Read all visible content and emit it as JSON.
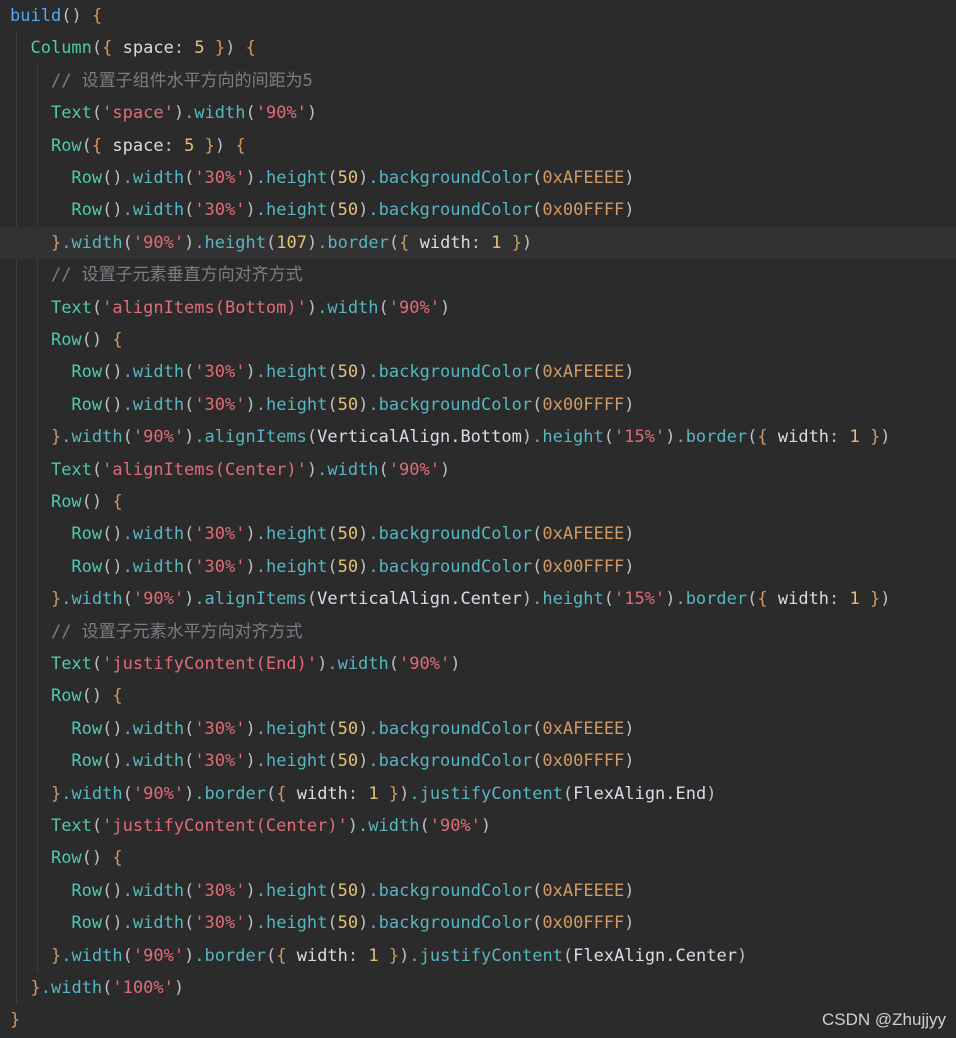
{
  "editor": {
    "lines": [
      "build() {",
      "  Column({ space: 5 }) {",
      "    // 设置子组件水平方向的间距为5",
      "    Text('space').width('90%')",
      "    Row({ space: 5 }) {",
      "      Row().width('30%').height(50).backgroundColor(0xAFEEEE)",
      "      Row().width('30%').height(50).backgroundColor(0x00FFFF)",
      "    }.width('90%').height(107).border({ width: 1 })",
      "    // 设置子元素垂直方向对齐方式",
      "    Text('alignItems(Bottom)').width('90%')",
      "    Row() {",
      "      Row().width('30%').height(50).backgroundColor(0xAFEEEE)",
      "      Row().width('30%').height(50).backgroundColor(0x00FFFF)",
      "    }.width('90%').alignItems(VerticalAlign.Bottom).height('15%').border({ width: 1 })",
      "    Text('alignItems(Center)').width('90%')",
      "    Row() {",
      "      Row().width('30%').height(50).backgroundColor(0xAFEEEE)",
      "      Row().width('30%').height(50).backgroundColor(0x00FFFF)",
      "    }.width('90%').alignItems(VerticalAlign.Center).height('15%').border({ width: 1 })",
      "    // 设置子元素水平方向对齐方式",
      "    Text('justifyContent(End)').width('90%')",
      "    Row() {",
      "      Row().width('30%').height(50).backgroundColor(0xAFEEEE)",
      "      Row().width('30%').height(50).backgroundColor(0x00FFFF)",
      "    }.width('90%').border({ width: 1 }).justifyContent(FlexAlign.End)",
      "    Text('justifyContent(Center)').width('90%')",
      "    Row() {",
      "      Row().width('30%').height(50).backgroundColor(0xAFEEEE)",
      "      Row().width('30%').height(50).backgroundColor(0x00FFFF)",
      "    }.width('90%').border({ width: 1 }).justifyContent(FlexAlign.Center)",
      "  }.width('100%')",
      "}"
    ],
    "current_line_index": 7
  },
  "colors": {
    "background": "#2b2b2b",
    "current_line": "#323232"
  },
  "watermark": "CSDN @Zhujjyy"
}
